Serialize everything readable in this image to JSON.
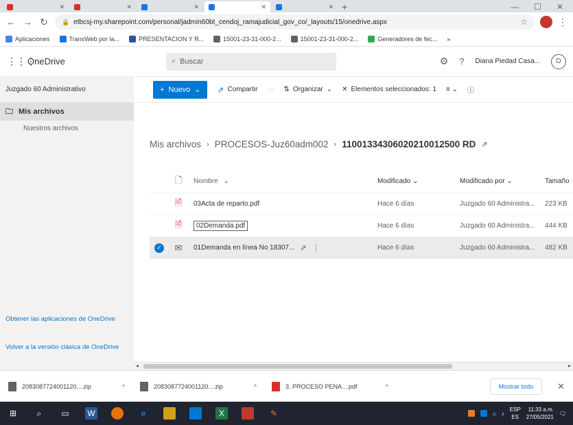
{
  "browser": {
    "tabs": [
      {
        "label": "",
        "color": "#d93025"
      },
      {
        "label": "",
        "color": "#d93025"
      },
      {
        "label": "",
        "color": "#1a73e8"
      },
      {
        "label": "",
        "color": "#1a73e8",
        "active": true
      },
      {
        "label": "",
        "color": "#1a73e8"
      }
    ],
    "url": "etbcsj-my.sharepoint.com/personal/jadmin60bt_cendoj_ramajudicial_gov_co/_layouts/15/onedrive.aspx",
    "bookmarks": [
      {
        "label": "Aplicaciones",
        "color": "#4285f4"
      },
      {
        "label": "TransWeb por la...",
        "color": "#1a73e8"
      },
      {
        "label": "PRESENTACION Y R...",
        "color": "#2b579a"
      },
      {
        "label": "15001-23-31-000-2...",
        "color": "#5f6368"
      },
      {
        "label": "15001-23-31-000-2...",
        "color": "#5f6368"
      },
      {
        "label": "Generadores de fec...",
        "color": "#34a853"
      }
    ]
  },
  "suite": {
    "app_name": "OneDrive",
    "search_placeholder": "Buscar",
    "user_name": "Diana Piedad Casa...",
    "avatar_initial": "D"
  },
  "nav": {
    "org_name": "Juzgado 60 Administrativo",
    "items": [
      {
        "label": "Mis archivos"
      }
    ],
    "sub_items": [
      {
        "label": "Nuestros archivos"
      }
    ],
    "footer_links": [
      {
        "label": "Obtener las aplicaciones de OneDrive"
      },
      {
        "label": "Volver a la versión clásica de OneDrive"
      }
    ]
  },
  "commands": {
    "new": "Nuevo",
    "share": "Compartir",
    "organize": "Organizar",
    "selected": "Elementos seleccionados: 1"
  },
  "breadcrumb": {
    "root": "Mis archivos",
    "folder": "PROCESOS-Juz60adm002",
    "current": "11001334306020210012500 RD"
  },
  "table": {
    "headers": {
      "name": "Nombre",
      "modified": "Modificado",
      "modified_by": "Modificado por",
      "size": "Tamaño"
    },
    "rows": [
      {
        "name": "03Acta de reparto.pdf",
        "modified": "Hace 6 días",
        "modified_by": "Juzgado 60 Administra...",
        "size": "223 KB",
        "type": "pdf",
        "selected": false,
        "renaming": false
      },
      {
        "name": "02Demanda.pdf",
        "modified": "Hace 6 días",
        "modified_by": "Juzgado 60 Administra...",
        "size": "444 KB",
        "type": "pdf",
        "selected": false,
        "renaming": true
      },
      {
        "name": "01Demanda en línea No 18307...",
        "modified": "Hace 6 días",
        "modified_by": "Juzgado 60 Administra...",
        "size": "482 KB",
        "type": "mail",
        "selected": true,
        "renaming": false
      }
    ]
  },
  "downloads": {
    "items": [
      {
        "label": "2083087724001120....zip"
      },
      {
        "label": "2083087724001120....zip"
      },
      {
        "label": "3. PROCESO PENA....pdf"
      }
    ],
    "show_all": "Mostrar todo"
  },
  "taskbar": {
    "lang": "ESP",
    "region": "ES",
    "time": "11:33 a.m.",
    "date": "27/05/2021"
  },
  "colors": {
    "accent": "#0078d4",
    "pdf": "#d13438"
  }
}
